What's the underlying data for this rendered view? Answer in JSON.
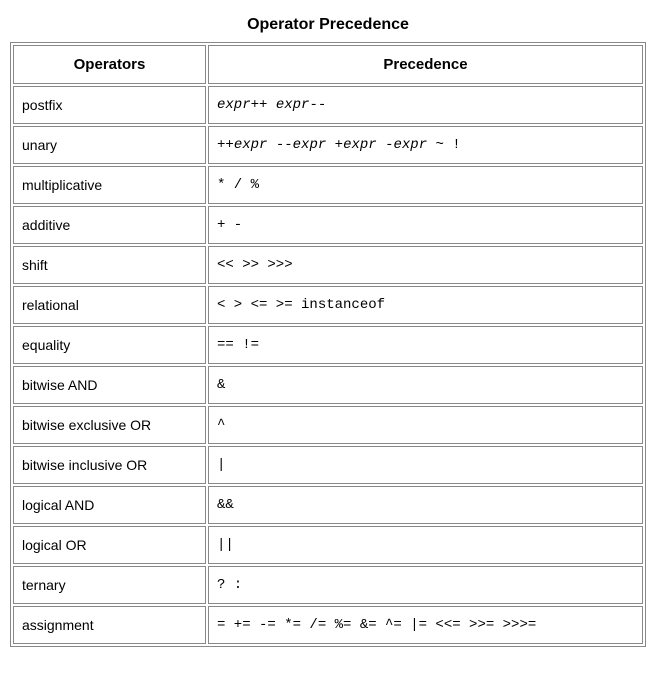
{
  "title": "Operator Precedence",
  "headers": {
    "operators": "Operators",
    "precedence": "Precedence"
  },
  "rows": [
    {
      "op": "postfix",
      "prec_html": "<span class='expr'>expr</span>++ <span class='expr'>expr</span>--"
    },
    {
      "op": "unary",
      "prec_html": "++<span class='expr'>expr</span> --<span class='expr'>expr</span> +<span class='expr'>expr</span> -<span class='expr'>expr</span> ~ !"
    },
    {
      "op": "multiplicative",
      "prec_html": "* / %"
    },
    {
      "op": "additive",
      "prec_html": "+ -"
    },
    {
      "op": "shift",
      "prec_html": "&lt;&lt; &gt;&gt; &gt;&gt;&gt;"
    },
    {
      "op": "relational",
      "prec_html": "&lt; &gt; &lt;= &gt;= instanceof"
    },
    {
      "op": "equality",
      "prec_html": "== !="
    },
    {
      "op": "bitwise AND",
      "prec_html": "&amp;"
    },
    {
      "op": "bitwise exclusive OR",
      "prec_html": "^"
    },
    {
      "op": "bitwise inclusive OR",
      "prec_html": "|"
    },
    {
      "op": "logical AND",
      "prec_html": "&amp;&amp;"
    },
    {
      "op": "logical OR",
      "prec_html": "||"
    },
    {
      "op": "ternary",
      "prec_html": "? :"
    },
    {
      "op": "assignment",
      "prec_html": "= += -= *= /= %= &amp;= ^= |= &lt;&lt;= &gt;&gt;= &gt;&gt;&gt;="
    }
  ],
  "chart_data": {
    "type": "table",
    "title": "Operator Precedence",
    "columns": [
      "Operators",
      "Precedence"
    ],
    "rows": [
      [
        "postfix",
        "expr++ expr--"
      ],
      [
        "unary",
        "++expr --expr +expr -expr ~ !"
      ],
      [
        "multiplicative",
        "* / %"
      ],
      [
        "additive",
        "+ -"
      ],
      [
        "shift",
        "<< >> >>>"
      ],
      [
        "relational",
        "< > <= >= instanceof"
      ],
      [
        "equality",
        "== !="
      ],
      [
        "bitwise AND",
        "&"
      ],
      [
        "bitwise exclusive OR",
        "^"
      ],
      [
        "bitwise inclusive OR",
        "|"
      ],
      [
        "logical AND",
        "&&"
      ],
      [
        "logical OR",
        "||"
      ],
      [
        "ternary",
        "? :"
      ],
      [
        "assignment",
        "= += -= *= /= %= &= ^= |= <<= >>= >>>="
      ]
    ]
  }
}
